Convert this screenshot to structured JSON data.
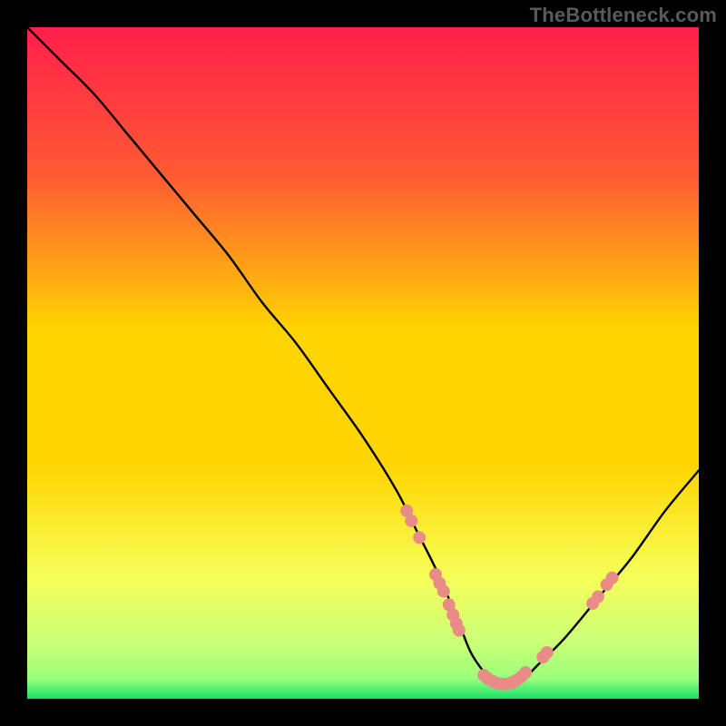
{
  "watermark": "TheBottleneck.com",
  "chart_data": {
    "type": "line",
    "title": "",
    "xlabel": "",
    "ylabel": "",
    "xlim": [
      0,
      100
    ],
    "ylim": [
      0,
      100
    ],
    "background_palette": {
      "top": "#ff1f4b",
      "upper_mid": "#ff6a2a",
      "mid": "#ffd400",
      "lower_mid": "#f6ff5a",
      "near_bottom": "#9aff7a",
      "bottom": "#17e06a"
    },
    "series": [
      {
        "name": "bottleneck-curve",
        "color": "#000000",
        "x": [
          0,
          2,
          5,
          10,
          15,
          20,
          25,
          30,
          35,
          40,
          45,
          50,
          55,
          58,
          61,
          64,
          66,
          68,
          70,
          72,
          74,
          76,
          80,
          85,
          90,
          95,
          100
        ],
        "y": [
          100,
          98,
          95,
          90,
          84,
          78,
          72,
          66,
          59,
          53,
          46,
          39,
          31,
          25,
          19,
          12,
          7,
          4,
          2,
          2,
          3,
          5,
          9,
          15,
          21,
          28,
          34
        ]
      }
    ],
    "markers": {
      "name": "highlight-dots",
      "color": "#e98b86",
      "radius_px": 7,
      "points": [
        {
          "x": 56.5,
          "y": 28.0
        },
        {
          "x": 57.2,
          "y": 26.5
        },
        {
          "x": 58.4,
          "y": 24.0
        },
        {
          "x": 60.8,
          "y": 18.5
        },
        {
          "x": 61.4,
          "y": 17.2
        },
        {
          "x": 62.0,
          "y": 16.0
        },
        {
          "x": 62.8,
          "y": 14.0
        },
        {
          "x": 63.4,
          "y": 12.5
        },
        {
          "x": 63.9,
          "y": 11.2
        },
        {
          "x": 64.3,
          "y": 10.2
        },
        {
          "x": 68.0,
          "y": 3.5
        },
        {
          "x": 68.6,
          "y": 3.0
        },
        {
          "x": 69.3,
          "y": 2.6
        },
        {
          "x": 70.0,
          "y": 2.3
        },
        {
          "x": 70.7,
          "y": 2.2
        },
        {
          "x": 71.4,
          "y": 2.2
        },
        {
          "x": 72.1,
          "y": 2.4
        },
        {
          "x": 72.8,
          "y": 2.7
        },
        {
          "x": 73.5,
          "y": 3.2
        },
        {
          "x": 74.2,
          "y": 3.9
        },
        {
          "x": 76.8,
          "y": 6.2
        },
        {
          "x": 77.4,
          "y": 6.9
        },
        {
          "x": 84.2,
          "y": 14.2
        },
        {
          "x": 85.0,
          "y": 15.2
        },
        {
          "x": 86.3,
          "y": 17.0
        },
        {
          "x": 87.1,
          "y": 18.0
        }
      ]
    }
  }
}
